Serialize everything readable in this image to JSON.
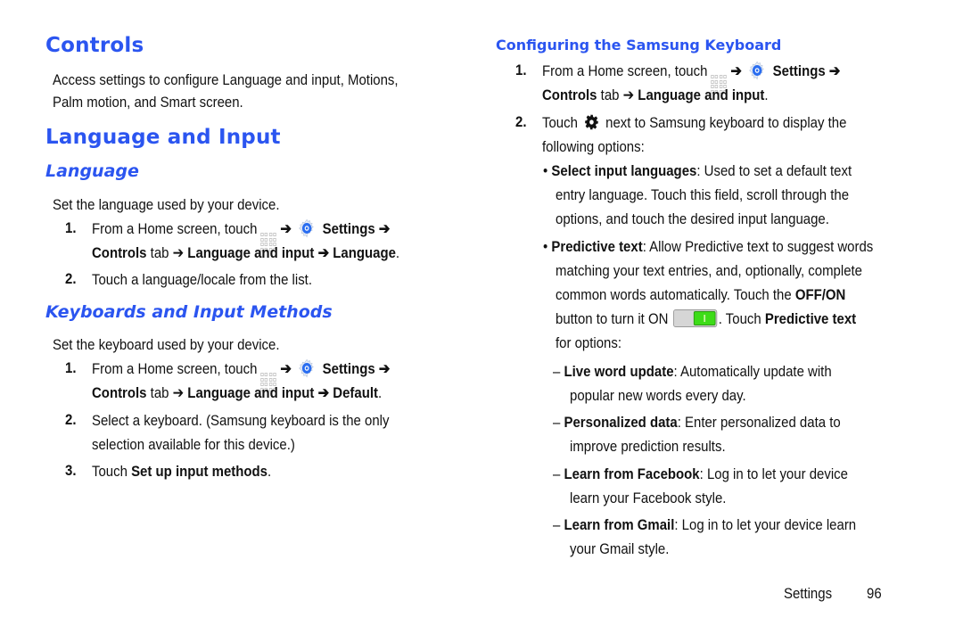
{
  "left": {
    "controls_heading": "Controls",
    "controls_text_1": "Access settings to configure Language and input, Motions,",
    "controls_text_2": "Palm motion, and Smart screen.",
    "lang_input_heading": "Language and Input",
    "language_heading": "Language",
    "language_intro": "Set the language used by your device.",
    "language_steps": [
      {
        "num": "1.",
        "line1_pre": "From a Home screen, touch",
        "line1_arrow": "➔",
        "line1_bold": "Settings ➔",
        "line2_bold_a": "Controls",
        "line2_mid": " tab ➔ ",
        "line2_bold_b": "Language and input ➔ Language",
        "line2_end": "."
      },
      {
        "num": "2.",
        "text": "Touch a language/locale from the list."
      }
    ],
    "keyboards_heading": "Keyboards and Input Methods",
    "keyboards_intro": "Set the keyboard used by your device.",
    "keyboard_steps": [
      {
        "num": "1.",
        "line1_pre": "From a Home screen, touch",
        "line1_arrow": "➔",
        "line1_bold": "Settings ➔",
        "line2_bold_a": "Controls",
        "line2_mid": " tab ➔ ",
        "line2_bold_b": "Language and input ➔ Default",
        "line2_end": "."
      },
      {
        "num": "2.",
        "line1": "Select a keyboard. (Samsung keyboard is the only",
        "line2": "selection available for this device.)"
      },
      {
        "num": "3.",
        "pre": "Touch ",
        "bold": "Set up input methods",
        "end": "."
      }
    ]
  },
  "right": {
    "heading": "Configuring the Samsung Keyboard",
    "steps": [
      {
        "num": "1.",
        "line1_pre": "From a Home screen, touch",
        "line1_arrow": "➔",
        "line1_bold": "Settings ➔",
        "line2_bold_a": "Controls",
        "line2_mid": " tab ➔ ",
        "line2_bold_b": "Language and input",
        "line2_end": "."
      },
      {
        "num": "2.",
        "line1_pre": "Touch",
        "line1_post": "next to Samsung keyboard to display the",
        "line2": "following options:"
      }
    ],
    "bullets": [
      {
        "bullet": "•",
        "bold": "Select input languages",
        "line1": ": Used to set a default text",
        "line2": "entry language. Touch this field, scroll through the",
        "line3": "options, and touch the desired input language."
      },
      {
        "bullet": "•",
        "bold": "Predictive text",
        "line1": ": Allow Predictive text to suggest words",
        "line2": "matching your text entries, and, optionally, complete",
        "line3_pre": "common words automatically. Touch the ",
        "line3_bold": "OFF/ON",
        "line4_pre": "button to turn it ON",
        "line4_mid": ". Touch ",
        "line4_bold": "Predictive text",
        "line5": "for options:",
        "toggle_state": "ON"
      }
    ],
    "sub_options": [
      {
        "dash": "–",
        "bold": "Live word update",
        "line1": ": Automatically update with",
        "line2": "popular new words every day."
      },
      {
        "dash": "–",
        "bold": "Personalized data",
        "line1": ": Enter personalized data to",
        "line2": "improve prediction results."
      },
      {
        "dash": "–",
        "bold": "Learn from Facebook",
        "line1": ": Log in to let your device",
        "line2": "learn your Facebook style."
      },
      {
        "dash": "–",
        "bold": "Learn from Gmail",
        "line1": ": Log in to let your device learn",
        "line2": "your Gmail style."
      }
    ]
  },
  "footer": {
    "section": "Settings",
    "page": "96"
  },
  "colors": {
    "heading_blue": "#2b55f0",
    "toggle_green": "#3ddc18",
    "settings_icon_blue": "#2a6df0"
  }
}
